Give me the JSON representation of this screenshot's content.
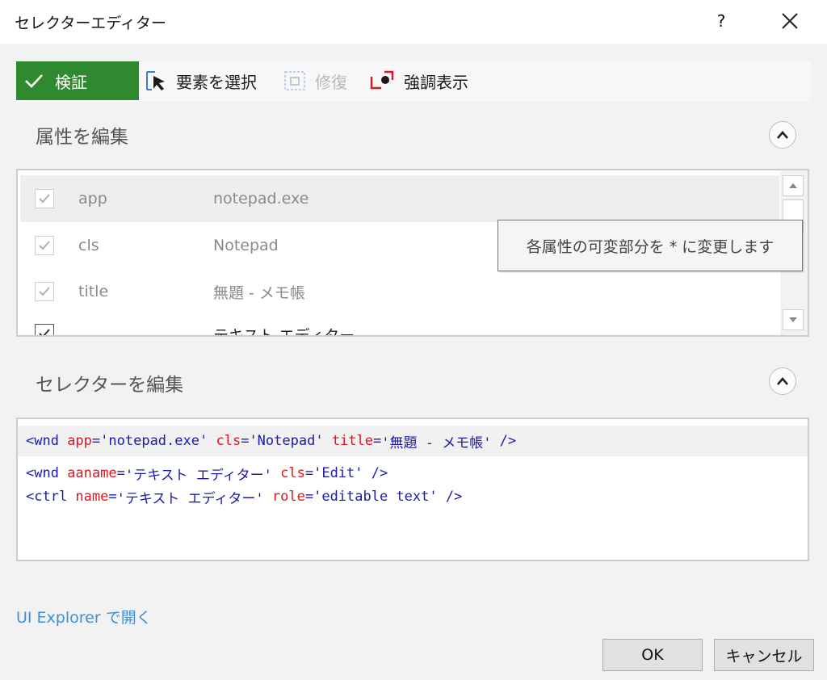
{
  "window": {
    "title": "セレクターエディター",
    "help": "?",
    "close_glyph": "✕"
  },
  "toolbar": {
    "validate_label": "検証",
    "select_element_label": "要素を選択",
    "repair_label": "修復",
    "highlight_label": "強調表示",
    "accent_color": "#2f8a2f"
  },
  "attributes_section": {
    "title": "属性を編集",
    "rows": [
      {
        "checked": true,
        "name": "app",
        "value": "notepad.exe"
      },
      {
        "checked": true,
        "name": "cls",
        "value": "Notepad"
      },
      {
        "checked": true,
        "name": "title",
        "value": "無題 - メモ帳"
      },
      {
        "checked": true,
        "name": "",
        "value": "テキスト エディター"
      }
    ],
    "tooltip": "各属性の可変部分を * に変更します"
  },
  "selector_section": {
    "title": "セレクターを編集",
    "line1": {
      "tag_open": "<wnd ",
      "a1": "app",
      "v1": "'notepad.exe'",
      "a2": "cls",
      "v2": "'Notepad'",
      "a3": "title",
      "v3": "'無題 - メモ帳'",
      "close": " />"
    },
    "line2": {
      "tag_open": "<wnd ",
      "a1": "aaname",
      "v1": "'テキスト エディター'",
      "a2": "cls",
      "v2": "'Edit'",
      "close": " />"
    },
    "line3": {
      "tag_open": "<ctrl ",
      "a1": "name",
      "v1": "'テキスト エディター'",
      "a2": "role",
      "v2": "'editable text'",
      "close": " />"
    }
  },
  "footer": {
    "ui_explorer_link": "UI Explorer で開く",
    "ok_label": "OK",
    "cancel_label": "キャンセル"
  }
}
